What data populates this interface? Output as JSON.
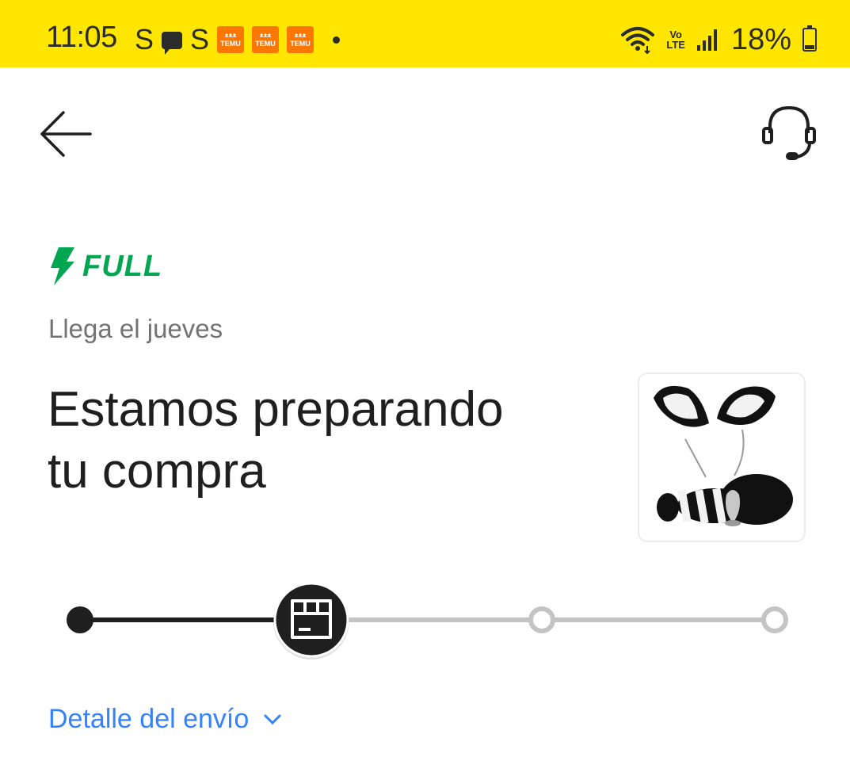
{
  "status_bar": {
    "time": "11:05",
    "left_icons": [
      "S",
      "message-icon",
      "S",
      "temu-icon",
      "temu-icon",
      "temu-icon"
    ],
    "temu_label": "TEMU",
    "s_letter": "S",
    "network": "Vo LTE",
    "network_top": "Vo",
    "network_bottom": "LTE",
    "battery_percent": "18%",
    "battery_level": 0.18,
    "background_color": "#ffe600"
  },
  "header": {
    "back_icon": "arrow-left-icon",
    "support_icon": "headset-icon"
  },
  "shipment": {
    "badge_label": "FULL",
    "badge_color": "#00a650",
    "eta": "Llega el jueves",
    "headline_line1": "Estamos preparando",
    "headline_line2": "tu compra",
    "product_image": "cat-ears-headband-and-tail"
  },
  "tracker": {
    "steps_total": 4,
    "current_step": 2,
    "current_icon": "package-icon",
    "completed_color": "#1f1f1f",
    "pending_color": "#c4c4c4"
  },
  "detail_link": {
    "label": "Detalle del envío",
    "icon": "chevron-down-icon",
    "color": "#3483fa"
  }
}
